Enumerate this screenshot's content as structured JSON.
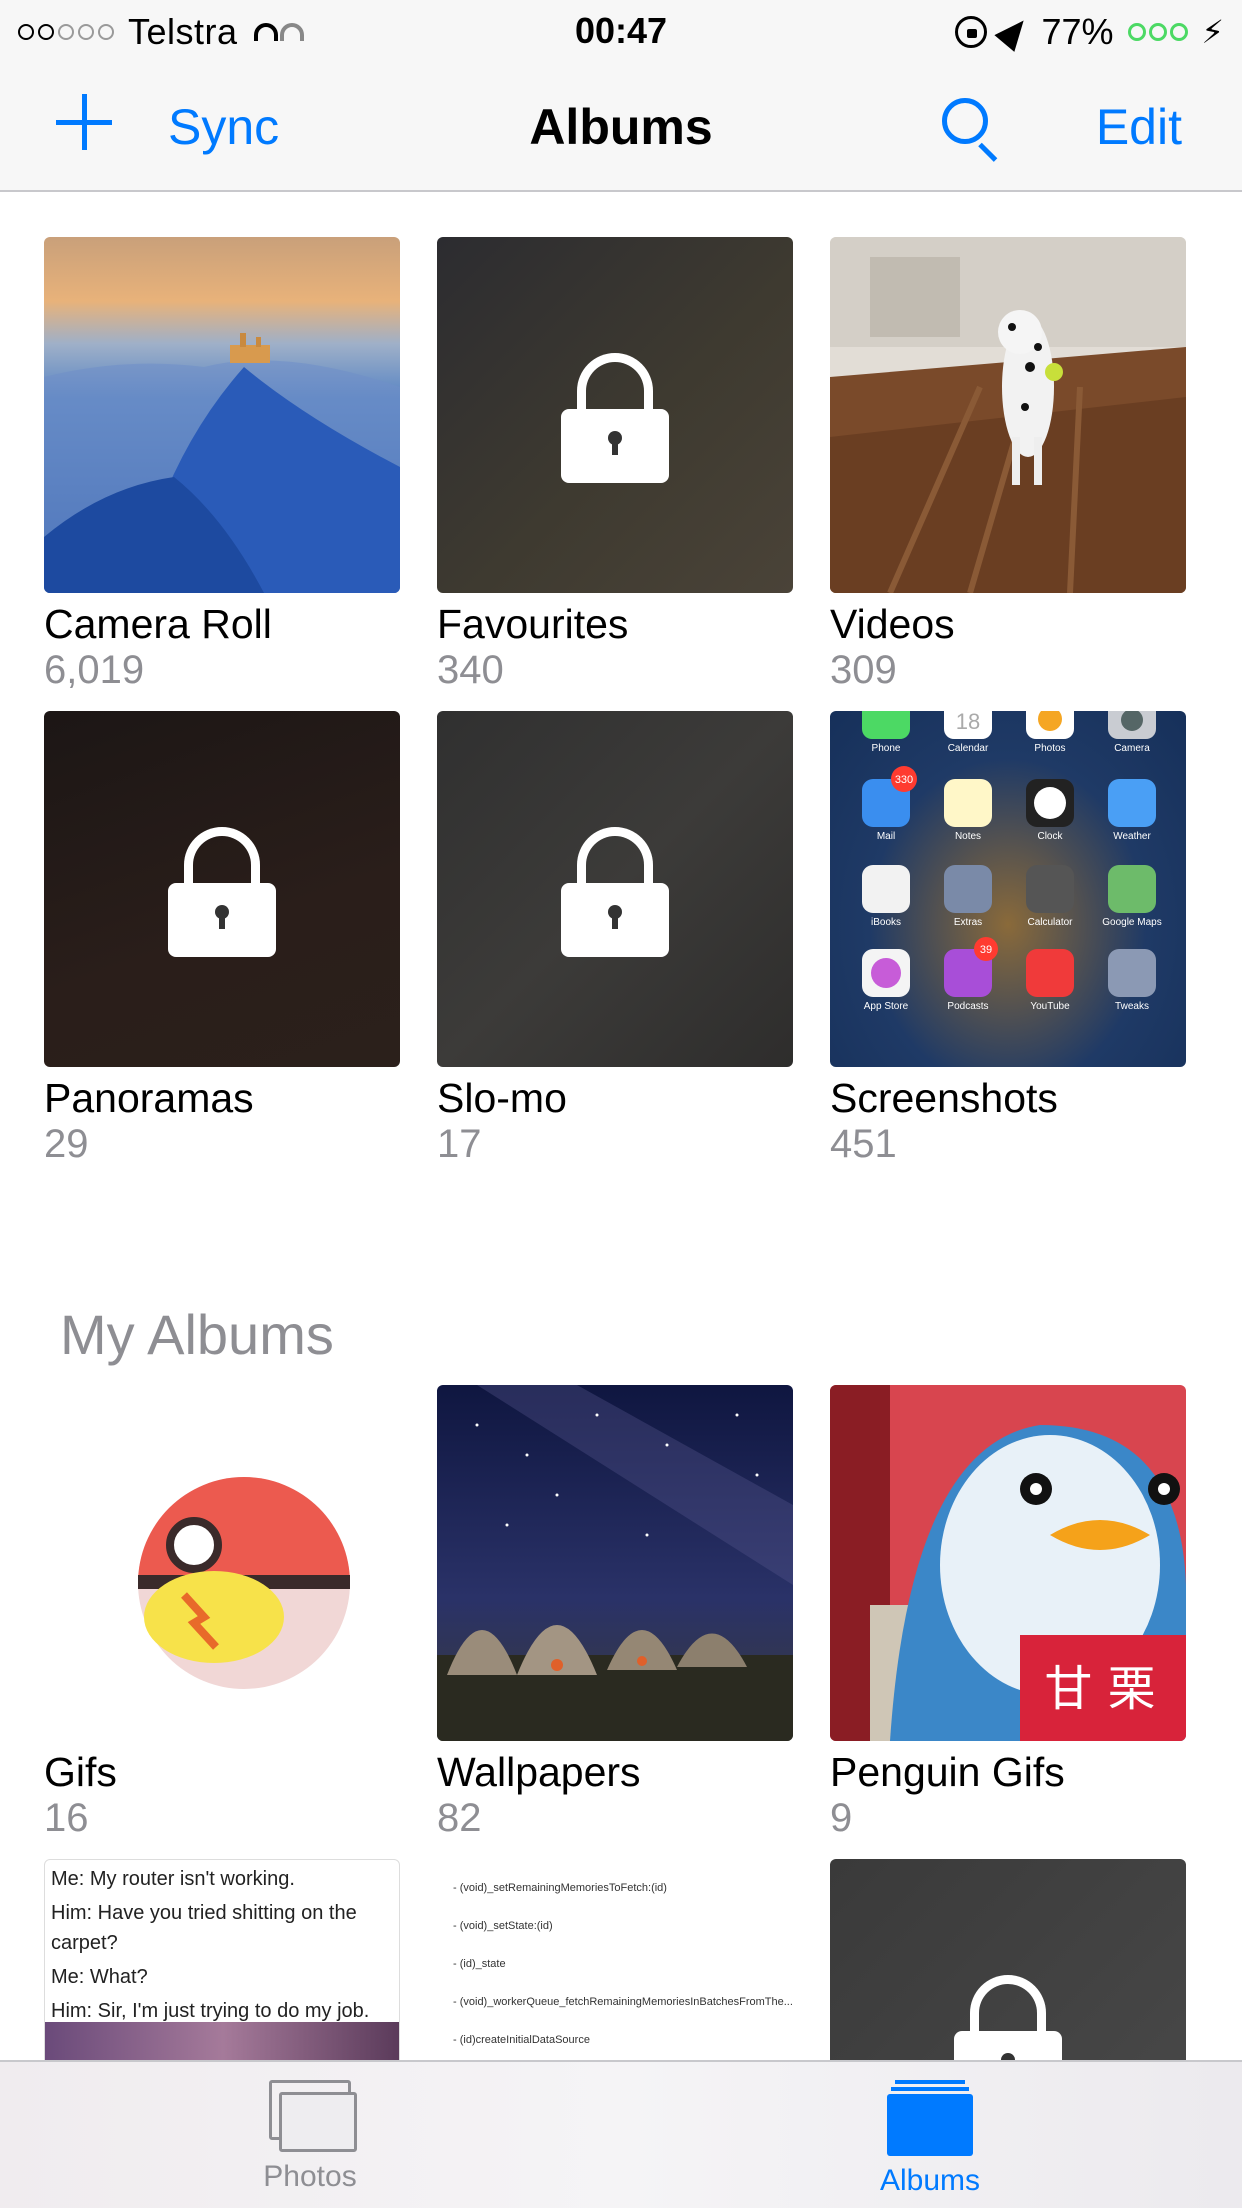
{
  "status_bar": {
    "carrier": "Telstra",
    "time": "00:47",
    "battery": "77%",
    "icons": [
      "signal-dots-icon",
      "wifi-icon",
      "rotation-lock-icon",
      "location-arrow-icon",
      "battery-icon",
      "charging-bolt-icon"
    ]
  },
  "nav": {
    "sync_label": "Sync",
    "title": "Albums",
    "edit_label": "Edit",
    "icons": [
      "plus-icon",
      "search-icon"
    ]
  },
  "albums": [
    {
      "name": "Camera Roll",
      "count": "6,019"
    },
    {
      "name": "Favourites",
      "count": "340"
    },
    {
      "name": "Videos",
      "count": "309"
    },
    {
      "name": "Panoramas",
      "count": "29"
    },
    {
      "name": "Slo-mo",
      "count": "17"
    },
    {
      "name": "Screenshots",
      "count": "451"
    }
  ],
  "my_albums": {
    "title": "My Albums",
    "items": [
      {
        "name": "Gifs",
        "count": "16"
      },
      {
        "name": "Wallpapers",
        "count": "82"
      },
      {
        "name": "Penguin Gifs",
        "count": "9"
      }
    ],
    "partial_thumbs": {
      "text_post": [
        "Me: My router isn't working.",
        "Him: Have you tried shitting on the carpet?",
        "Me: What?",
        "Him: Sir, I'm just trying to do my job."
      ],
      "code_lines": [
        "- (void)_setRemainingMemoriesToFetch:(id)",
        "- (void)_setState:(id)",
        "- (id)_state",
        "- (void)_workerQueue_fetchRemainingMemoriesInBatchesFromThe...",
        "- (id)createInitialDataSource"
      ]
    }
  },
  "screenshot_icons": [
    [
      "Phone",
      "Calendar",
      "Photos",
      "Camera"
    ],
    [
      "Mail",
      "Notes",
      "Clock",
      "Weather"
    ],
    [
      "iBooks",
      "Extras",
      "Calculator",
      "Google Maps"
    ],
    [
      "App Store",
      "Podcasts",
      "YouTube",
      "Tweaks"
    ]
  ],
  "screenshot_badges": {
    "mail": "330",
    "podcasts": "39",
    "calendar_day": "18"
  },
  "tabs": [
    {
      "label": "Photos",
      "selected": false
    },
    {
      "label": "Albums",
      "selected": true
    }
  ],
  "colors": {
    "accent": "#007aff",
    "secondary_text": "#8e8e93"
  }
}
